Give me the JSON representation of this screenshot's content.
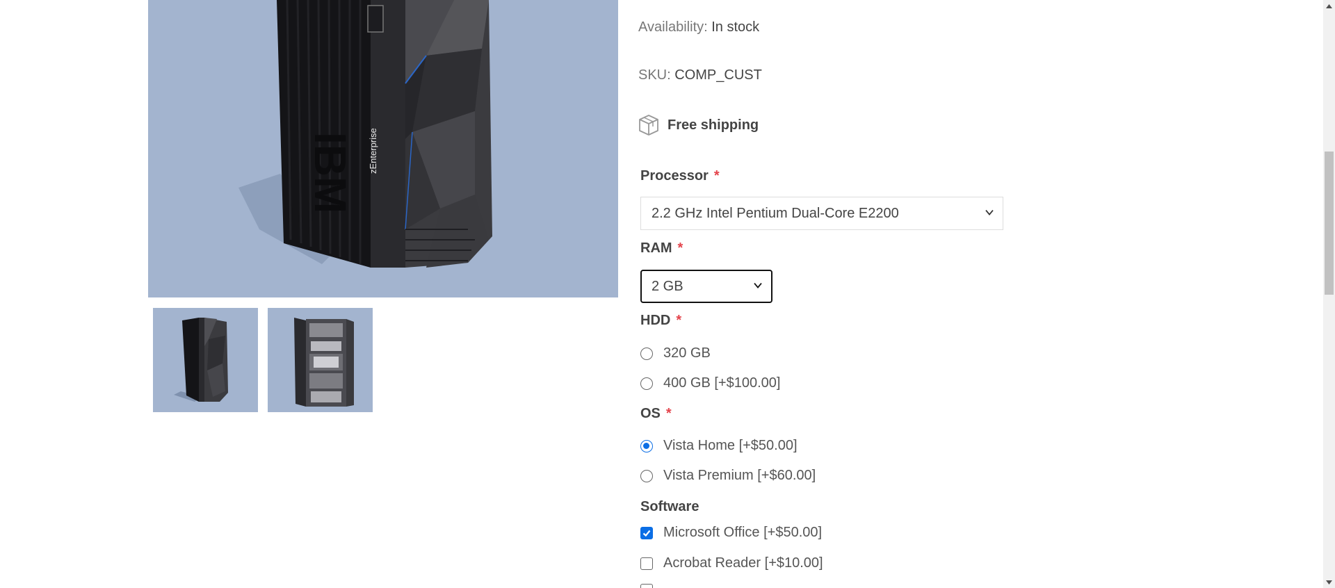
{
  "product": {
    "availability_label": "Availability:",
    "availability_value": "In stock",
    "sku_label": "SKU:",
    "sku_value": "COMP_CUST",
    "shipping_text": "Free shipping",
    "image_logo_text": "IBM",
    "image_model_text": "zEnterprise"
  },
  "attributes": {
    "required_mark": "*",
    "processor": {
      "label": "Processor",
      "selected": "2.2 GHz Intel Pentium Dual-Core E2200"
    },
    "ram": {
      "label": "RAM",
      "selected": "2 GB"
    },
    "hdd": {
      "label": "HDD",
      "options": [
        {
          "label": "320 GB",
          "checked": false
        },
        {
          "label": "400 GB [+$100.00]",
          "checked": false
        }
      ]
    },
    "os": {
      "label": "OS",
      "options": [
        {
          "label": "Vista Home [+$50.00]",
          "checked": true
        },
        {
          "label": "Vista Premium [+$60.00]",
          "checked": false
        }
      ]
    },
    "software": {
      "label": "Software",
      "options": [
        {
          "label": "Microsoft Office [+$50.00]",
          "checked": true
        },
        {
          "label": "Acrobat Reader [+$10.00]",
          "checked": false
        }
      ]
    }
  },
  "colors": {
    "image_background": "#a3b4cf",
    "required": "#e4434b",
    "accent": "#0b6ee5"
  },
  "icons": {
    "shipping": "package-box-icon",
    "select": "chevron-down-icon"
  }
}
